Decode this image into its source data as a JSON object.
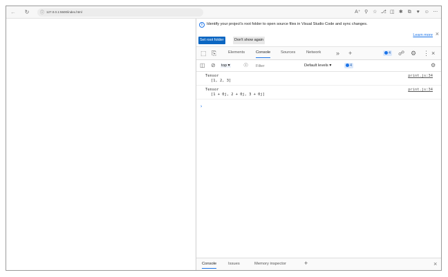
{
  "browser": {
    "url": "127.0.0.1:5500/index.html",
    "icons": [
      "back-icon",
      "refresh-icon",
      "info-icon",
      "read-aloud-icon",
      "zoom-icon",
      "favorite-icon",
      "extension-icon",
      "split-screen-icon",
      "favorites-bar-icon",
      "collections-icon",
      "browser-essentials-icon",
      "profile-icon",
      "more-icon"
    ]
  },
  "infobar": {
    "message": "Identify your project's root folder to open source files in Visual Studio Code and sync changes.",
    "learn_more": "Learn more",
    "set_root_button": "Set root folder",
    "dont_show_button": "Don't show again"
  },
  "tabs": {
    "items": [
      "Elements",
      "Console",
      "Sources",
      "Network"
    ],
    "active": "Console",
    "issues_count": "4"
  },
  "console_toolbar": {
    "context": "top ▾",
    "filter_placeholder": "Filter",
    "levels": "Default levels ▾",
    "issues_count": "4"
  },
  "console": {
    "messages": [
      {
        "title": "Tensor",
        "value": "[1, 2, 3]",
        "source": "print.js:34"
      },
      {
        "title": "Tensor",
        "value": "[1 + 0j, 2 + 0j, 3 + 0j]",
        "source": "print.js:34"
      }
    ],
    "prompt": "›"
  },
  "drawer": {
    "tabs": [
      "Console",
      "Issues",
      "Memory inspector"
    ],
    "active": "Console"
  },
  "colors": {
    "accent": "#1a73e8",
    "primary_button": "#0b66c2"
  }
}
